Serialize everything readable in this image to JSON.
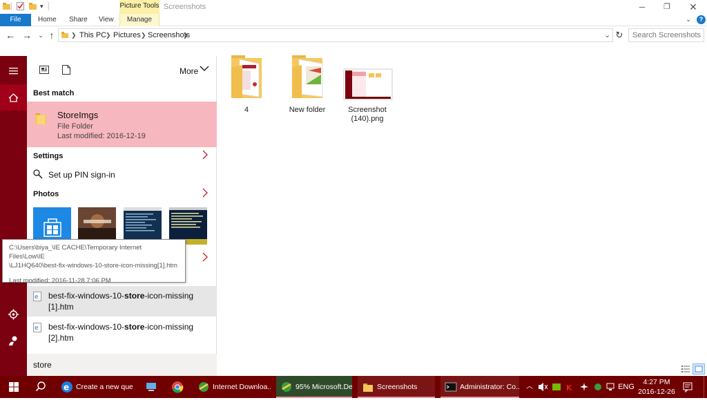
{
  "window": {
    "picture_tools": "Picture Tools",
    "title": "Screenshots"
  },
  "ribbon": {
    "tabs": [
      "File",
      "Home",
      "Share",
      "View",
      "Manage"
    ]
  },
  "address": {
    "path": [
      "This PC",
      "Pictures",
      "Screenshots"
    ],
    "search_placeholder": "Search Screenshots"
  },
  "files": [
    {
      "label": "4"
    },
    {
      "label": "New folder"
    },
    {
      "label": "Screenshot (140).png"
    }
  ],
  "start_menu": {
    "more_label": "More",
    "best_match_heading": "Best match",
    "best_match": {
      "name": "StoreImgs",
      "type": "File Folder",
      "modified": "Last modified: 2016-12-19"
    },
    "settings_heading": "Settings",
    "settings_item": "Set up PIN sign-in",
    "photos_heading": "Photos",
    "results": [
      {
        "prefix": "best-fix-windows-10-",
        "bold": "store",
        "suffix": "-icon-missing",
        "line2": "[1].htm"
      },
      {
        "prefix": "best-fix-windows-10-",
        "bold": "store",
        "suffix": "-icon-missing",
        "line2": "[2].htm"
      }
    ],
    "search_query": "store"
  },
  "tooltip": {
    "line1": "C:\\Users\\biya_\\IE CACHE\\Temporary Internet Files\\Low\\IE",
    "line2": "\\LJ1HQ640\\best-fix-windows-10-store-icon-missing[1].htm",
    "line3": "Last modified: 2016-11-28 7:06 PM"
  },
  "taskbar": {
    "items": [
      {
        "label": "Create a new que..."
      },
      {
        "label": "Internet Downloa..."
      },
      {
        "label": "95% Microsoft.De..."
      },
      {
        "label": "Screenshots"
      },
      {
        "label": "Administrator: Co..."
      }
    ],
    "language": "ENG",
    "time": "4:27 PM",
    "date": "2016-12-26"
  },
  "colors": {
    "accent": "#7b0010",
    "best_match_bg": "#f7b7be",
    "file_tab": "#1979ca",
    "taskbar": "#700000"
  }
}
